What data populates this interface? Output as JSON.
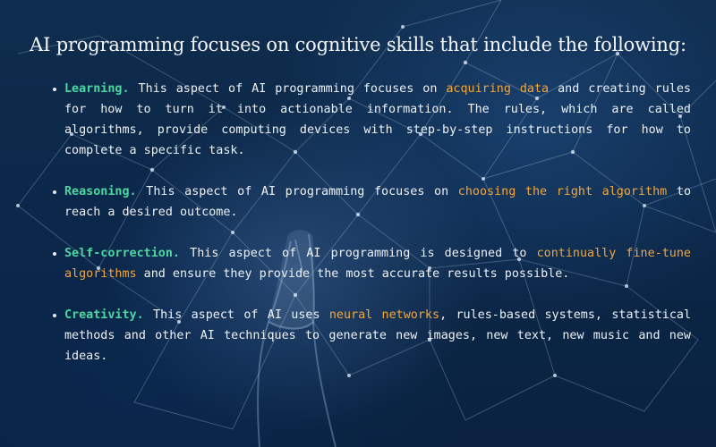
{
  "title": "AI programming focuses on cognitive skills that include the following:",
  "colors": {
    "background": "#0b2748",
    "term": "#4cd6a0",
    "highlight": "#f2a63b",
    "text": "#eef1f5"
  },
  "points": [
    {
      "term": "Learning.",
      "before": " This aspect of AI programming focuses on ",
      "highlight": "acquiring data",
      "after": " and creating rules for how to turn it into actionable information. The rules, which are called algorithms, provide computing devices with step-by-step instructions for how to complete a specific task."
    },
    {
      "term": "Reasoning.",
      "before": " This aspect of AI programming focuses on ",
      "highlight": "choosing the right algorithm",
      "after": " to reach a desired outcome."
    },
    {
      "term": "Self-correction.",
      "before": " This aspect of AI programming is designed to ",
      "highlight": "continually fine-tune algorithms",
      "after": " and ensure they provide the most accurate results possible."
    },
    {
      "term": "Creativity.",
      "before": " This aspect of AI uses ",
      "highlight": "neural networks",
      "after": ", rules-based systems, statistical methods and other AI techniques to generate new images, new text, new music and new ideas."
    }
  ]
}
